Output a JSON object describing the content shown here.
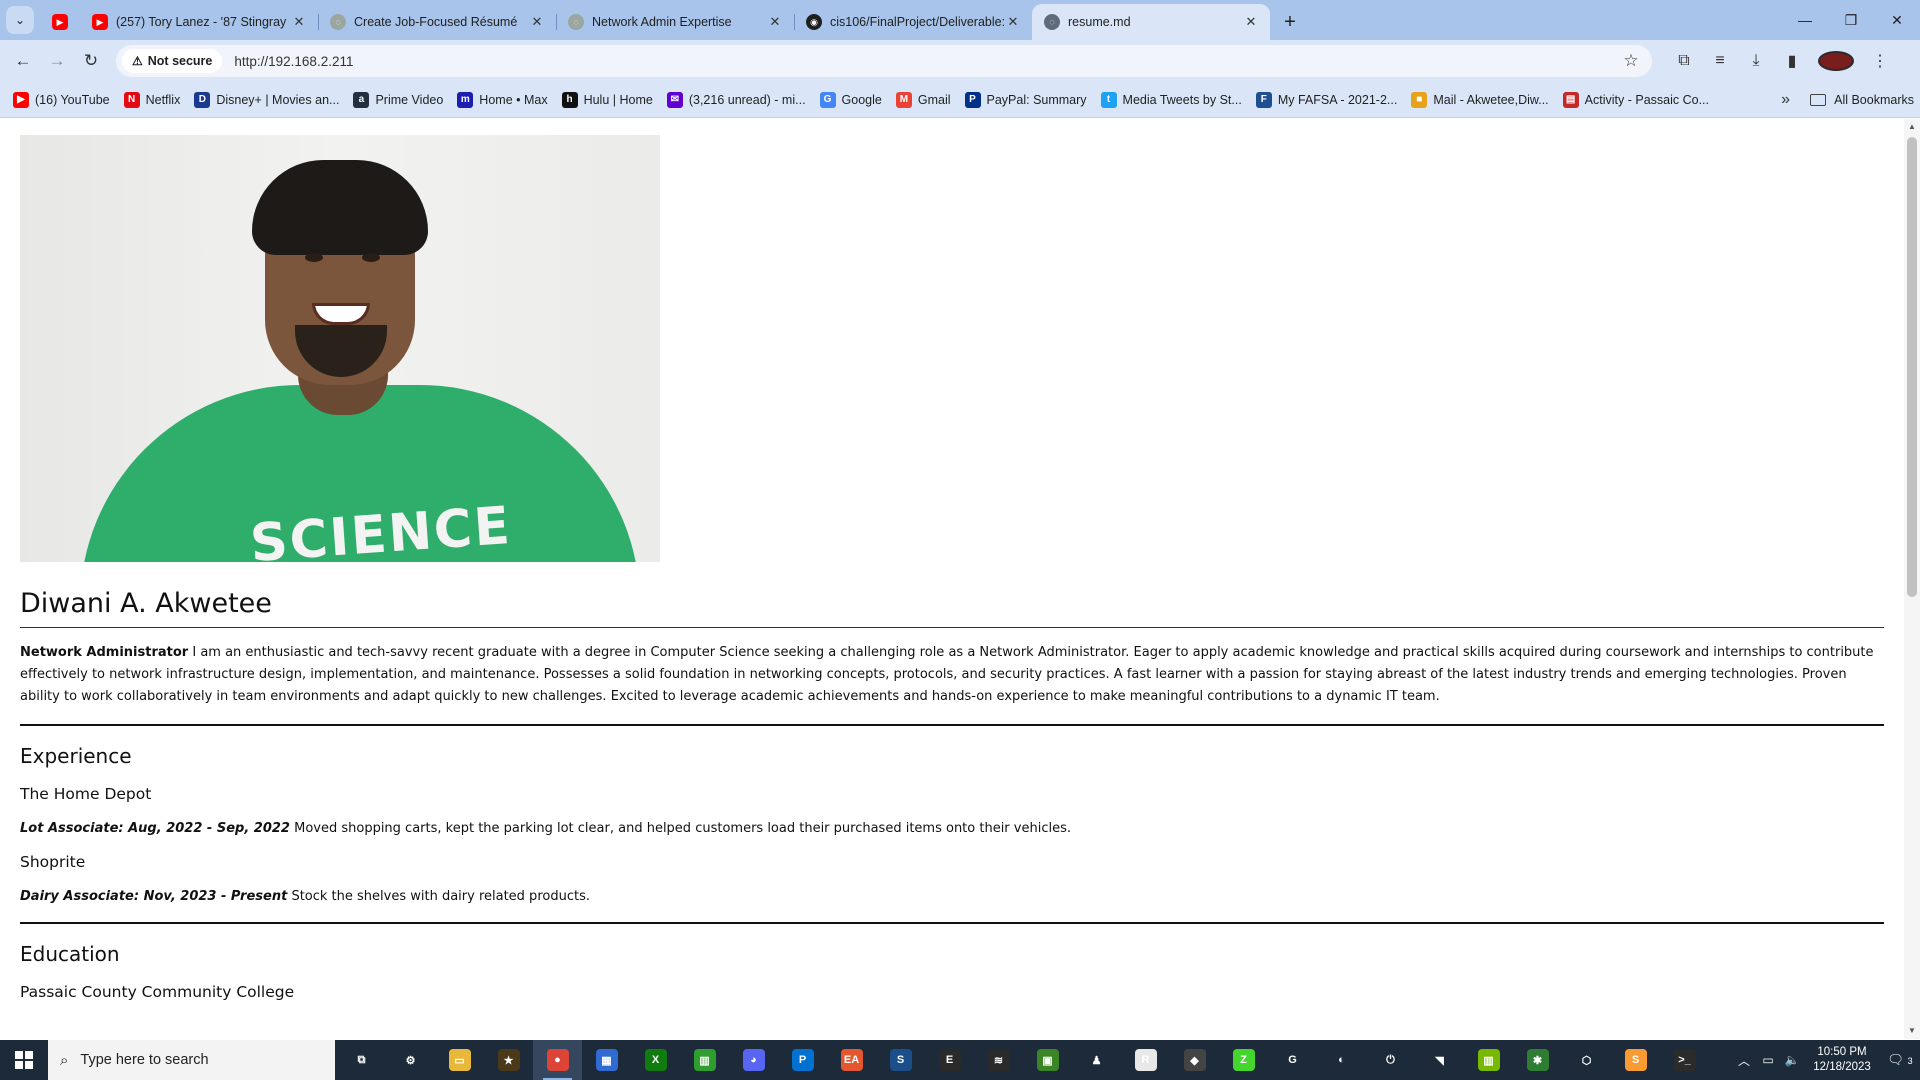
{
  "browser": {
    "tabs": [
      {
        "title": "(257) Tory Lanez - '87 Stingray (",
        "favicon": "youtube-icon",
        "color": "#ff0000"
      },
      {
        "title": "Create Job-Focused Résumé",
        "favicon": "chatgpt-icon",
        "color": "#9aa6a0"
      },
      {
        "title": "Network Admin Expertise",
        "favicon": "chatgpt-icon",
        "color": "#9aa6a0"
      },
      {
        "title": "cis106/FinalProject/Deliverable:",
        "favicon": "github-icon",
        "color": "#1f1f1f"
      },
      {
        "title": "resume.md",
        "favicon": "globe-icon",
        "color": "#5f6b7a",
        "active": true
      }
    ],
    "url": "http://192.168.2.211",
    "security_label": "Not secure",
    "bookmarks": [
      {
        "label": "(16) YouTube",
        "icon": "youtube-icon",
        "color": "#ff0000",
        "glyph": "▶"
      },
      {
        "label": "Netflix",
        "icon": "netflix-icon",
        "color": "#e50914",
        "glyph": "N"
      },
      {
        "label": "Disney+ | Movies an...",
        "icon": "disney-icon",
        "color": "#1a3a8f",
        "glyph": "D"
      },
      {
        "label": "Prime Video",
        "icon": "amazon-icon",
        "color": "#232f3e",
        "glyph": "a"
      },
      {
        "label": "Home • Max",
        "icon": "max-icon",
        "color": "#1b1eb0",
        "glyph": "m"
      },
      {
        "label": "Hulu | Home",
        "icon": "hulu-icon",
        "color": "#111111",
        "glyph": "h"
      },
      {
        "label": "(3,216 unread) - mi...",
        "icon": "yahoo-mail-icon",
        "color": "#6001d2",
        "glyph": "✉"
      },
      {
        "label": "Google",
        "icon": "google-icon",
        "color": "#4285f4",
        "glyph": "G"
      },
      {
        "label": "Gmail",
        "icon": "gmail-icon",
        "color": "#ea4335",
        "glyph": "M"
      },
      {
        "label": "PayPal: Summary",
        "icon": "paypal-icon",
        "color": "#003087",
        "glyph": "P"
      },
      {
        "label": "Media Tweets by St...",
        "icon": "twitter-icon",
        "color": "#1da1f2",
        "glyph": "t"
      },
      {
        "label": "My FAFSA - 2021-2...",
        "icon": "fafsa-icon",
        "color": "#1d4f91",
        "glyph": "F"
      },
      {
        "label": "Mail - Akwetee,Diw...",
        "icon": "outlook-icon",
        "color": "#e8a21a",
        "glyph": "■"
      },
      {
        "label": "Activity - Passaic Co...",
        "icon": "canvas-icon",
        "color": "#c62828",
        "glyph": "▤"
      }
    ],
    "all_bookmarks_label": "All Bookmarks"
  },
  "resume": {
    "name": "Diwani A. Akwetee",
    "photo_shirt_text": "SCIENCE",
    "summary_title": "Network Administrator",
    "summary_text": "I am an enthusiastic and tech-savvy recent graduate with a degree in Computer Science seeking a challenging role as a Network Administrator. Eager to apply academic knowledge and practical skills acquired during coursework and internships to contribute effectively to network infrastructure design, implementation, and maintenance. Possesses a solid foundation in networking concepts, protocols, and security practices. A fast learner with a passion for staying abreast of the latest industry trends and emerging technologies. Proven ability to work collaboratively in team environments and adapt quickly to new challenges. Excited to leverage academic achievements and hands-on experience to make meaningful contributions to a dynamic IT team.",
    "experience_heading": "Experience",
    "jobs": [
      {
        "company": "The Home Depot",
        "role": "Lot Associate: Aug, 2022 - Sep, 2022",
        "description": "Moved shopping carts, kept the parking lot clear, and helped customers load their purchased items onto their vehicles."
      },
      {
        "company": "Shoprite",
        "role": "Dairy Associate: Nov, 2023 - Present",
        "description": "Stock the shelves with dairy related products."
      }
    ],
    "education_heading": "Education",
    "school": "Passaic County Community College"
  },
  "taskbar": {
    "search_placeholder": "Type here to search",
    "apps": [
      {
        "name": "task-view-icon",
        "color": "#1c2a3a",
        "glyph": "⧉"
      },
      {
        "name": "settings-icon",
        "color": "#1c2a3a",
        "glyph": "⚙"
      },
      {
        "name": "file-explorer-icon",
        "color": "#e8b83a",
        "glyph": "▭"
      },
      {
        "name": "star-app-icon",
        "color": "#4a3a1a",
        "glyph": "★"
      },
      {
        "name": "chrome-icon",
        "color": "#db4437",
        "glyph": "●"
      },
      {
        "name": "store-icon",
        "color": "#2f6bd1",
        "glyph": "▦"
      },
      {
        "name": "xbox-icon",
        "color": "#107c10",
        "glyph": "X"
      },
      {
        "name": "xbox-app-icon",
        "color": "#2e9e2e",
        "glyph": "▥"
      },
      {
        "name": "discord-icon",
        "color": "#5865f2",
        "glyph": "◕"
      },
      {
        "name": "playstation-icon",
        "color": "#0070d1",
        "glyph": "P"
      },
      {
        "name": "ea-icon",
        "color": "#e4572e",
        "glyph": "EA"
      },
      {
        "name": "steam-icon",
        "color": "#1b4f8a",
        "glyph": "S"
      },
      {
        "name": "epic-games-icon",
        "color": "#2a2a2a",
        "glyph": "E"
      },
      {
        "name": "ubisoft-icon",
        "color": "#2a2a2a",
        "glyph": "≋"
      },
      {
        "name": "minecraft-icon",
        "color": "#3c8527",
        "glyph": "▣"
      },
      {
        "name": "joystick-icon",
        "color": "#1c2a3a",
        "glyph": "♟"
      },
      {
        "name": "rockstar-icon",
        "color": "#e8e8e8",
        "glyph": "R"
      },
      {
        "name": "game-launcher-icon",
        "color": "#444444",
        "glyph": "◆"
      },
      {
        "name": "razer-icon",
        "color": "#44d62c",
        "glyph": "Z"
      },
      {
        "name": "logitech-icon",
        "color": "#1c2a3a",
        "glyph": "G"
      },
      {
        "name": "battle-icon",
        "color": "#1c2a3a",
        "glyph": "◐"
      },
      {
        "name": "power-icon",
        "color": "#1c2a3a",
        "glyph": "⏻"
      },
      {
        "name": "nvidia-icon",
        "color": "#1c2a3a",
        "glyph": "◥"
      },
      {
        "name": "geforce-icon",
        "color": "#76b900",
        "glyph": "▥"
      },
      {
        "name": "razer-synapse-icon",
        "color": "#2e7d32",
        "glyph": "✱"
      },
      {
        "name": "virtualbox-icon",
        "color": "#1c2a3a",
        "glyph": "⬡"
      },
      {
        "name": "sublime-icon",
        "color": "#f79b32",
        "glyph": "S"
      },
      {
        "name": "terminal-icon",
        "color": "#2b2b2b",
        "glyph": ">_"
      }
    ],
    "time": "10:50 PM",
    "date": "12/18/2023",
    "notification_count": "3"
  }
}
